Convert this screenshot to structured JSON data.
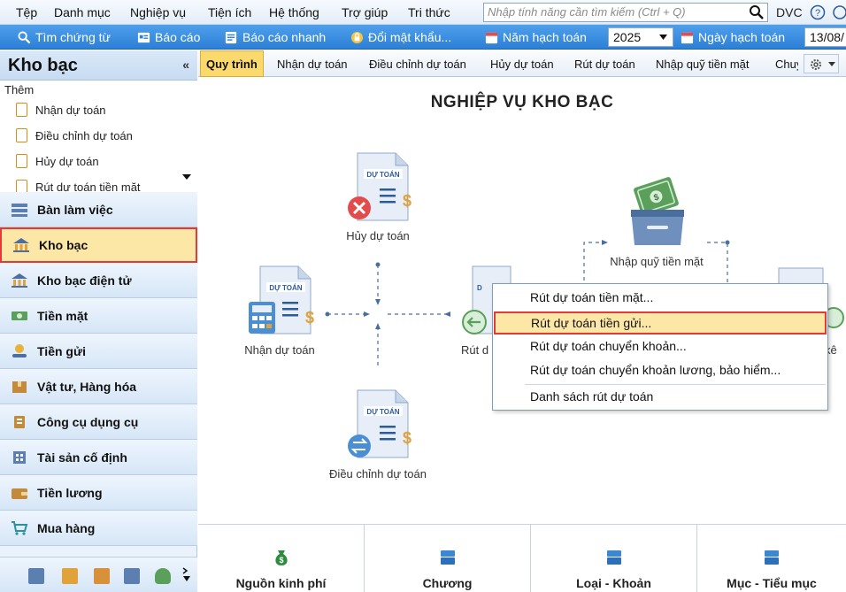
{
  "menubar": {
    "items": [
      "Tệp",
      "Danh mục",
      "Nghiệp vụ",
      "Tiện ích",
      "Hệ thống",
      "Trợ giúp",
      "Tri thức"
    ],
    "search_placeholder": "Nhập tính năng cần tìm kiếm (Ctrl + Q)",
    "dvc_label": "DVC"
  },
  "toolbar": {
    "find_voucher": "Tìm chứng từ",
    "report": "Báo cáo",
    "quick_report": "Báo cáo nhanh",
    "change_password": "Đổi mật khẩu...",
    "fiscal_year_label": "Năm hạch toán",
    "fiscal_year_value": "2025",
    "posting_date_label": "Ngày hạch toán",
    "posting_date_value": "13/08/"
  },
  "sidebar": {
    "title": "Kho bạc",
    "collapse_glyph": "«",
    "add_label": "Thêm",
    "add_items": [
      "Nhận dự toán",
      "Điều chỉnh dự toán",
      "Hủy dự toán",
      "Rút dự toán tiền mặt"
    ],
    "nav": [
      "Bàn làm việc",
      "Kho bạc",
      "Kho bạc điện tử",
      "Tiền mặt",
      "Tiền gửi",
      "Vật tư, Hàng hóa",
      "Công cụ dụng cụ",
      "Tài sản cố định",
      "Tiền lương",
      "Mua hàng"
    ],
    "active_nav": "Kho bạc"
  },
  "tabs": [
    "Quy trình",
    "Nhận dự toán",
    "Điều chỉnh dự toán",
    "Hủy dự toán",
    "Rút dự toán",
    "Nhập quỹ tiền mặt",
    "Chuy"
  ],
  "diagram": {
    "title": "NGHIỆP VỤ KHO BẠC",
    "doc_label": "DỰ TOÁN",
    "cancel": "Hủy dự toán",
    "receive": "Nhận dự toán",
    "adjust": "Điều chỉnh dự toán",
    "withdraw": "Rút d",
    "cash_in": "Nhập quỹ tiền mặt",
    "right_partial": "kê"
  },
  "context_menu": {
    "items": [
      "Rút dự toán tiền mặt...",
      "Rút dự toán tiền gửi...",
      "Rút dự toán chuyển khoản...",
      "Rút dự toán chuyển khoản lương, bảo hiểm...",
      "Danh sách rút dự toán"
    ],
    "highlighted": "Rút dự toán tiền gửi..."
  },
  "cards": [
    "Nguồn kinh phí",
    "Chương",
    "Loại - Khoản",
    "Mục - Tiểu mục"
  ],
  "colors": {
    "accent": "#2d7fd6",
    "highlight_border": "#e53935",
    "highlight_fill": "#fde7a7",
    "tab_active": "#fcd96c"
  }
}
